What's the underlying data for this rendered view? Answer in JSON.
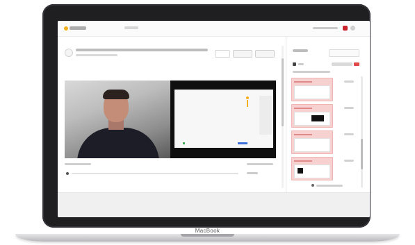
{
  "device": {
    "brand_label": "MacBook"
  },
  "app": {
    "logo_icon": "app-logo-icon",
    "brand_color": "#f2b01e",
    "accent_color": "#f7d0d0",
    "accent_border": "#efb4b4",
    "header_flag_color": "#c8202c"
  },
  "video": {
    "title": "",
    "subtitle": "",
    "meta_left": "",
    "meta_right": ""
  },
  "transcript": {
    "text": ""
  },
  "sidebar": {
    "tab_label": "",
    "link_label": "",
    "heading": "",
    "slides": [
      {
        "title": "",
        "time": ""
      },
      {
        "title": "",
        "time": ""
      },
      {
        "title": "",
        "time": ""
      },
      {
        "title": "",
        "time": ""
      }
    ],
    "more_label": ""
  }
}
